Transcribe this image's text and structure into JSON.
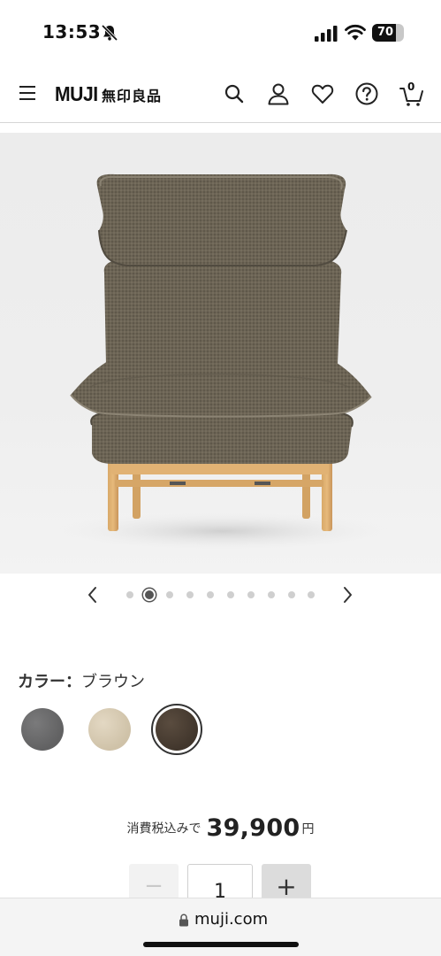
{
  "status_bar": {
    "time": "13:53",
    "battery": "70"
  },
  "header": {
    "logo_en": "MUJI",
    "logo_jp": "無印良品",
    "cart_count": "0",
    "icons": [
      "menu-icon",
      "search-icon",
      "account-icon",
      "heart-icon",
      "help-icon",
      "cart-icon"
    ]
  },
  "product": {
    "image_alt": "armchair-sofa-brown",
    "carousel": {
      "total": 10,
      "active_index": 1
    }
  },
  "color": {
    "label": "カラー：",
    "selected": "ブラウン",
    "swatches": [
      {
        "name": "gray",
        "color": "#6b6b6c"
      },
      {
        "name": "beige",
        "color": "#d9cdb6"
      },
      {
        "name": "brown",
        "color": "#4b3f34",
        "selected": true
      }
    ]
  },
  "price": {
    "prefix": "消費税込みで",
    "value": "39,900",
    "unit": "円"
  },
  "quantity": {
    "minus": "−",
    "value": "1",
    "plus": "+"
  },
  "browser": {
    "url": "muji.com"
  }
}
